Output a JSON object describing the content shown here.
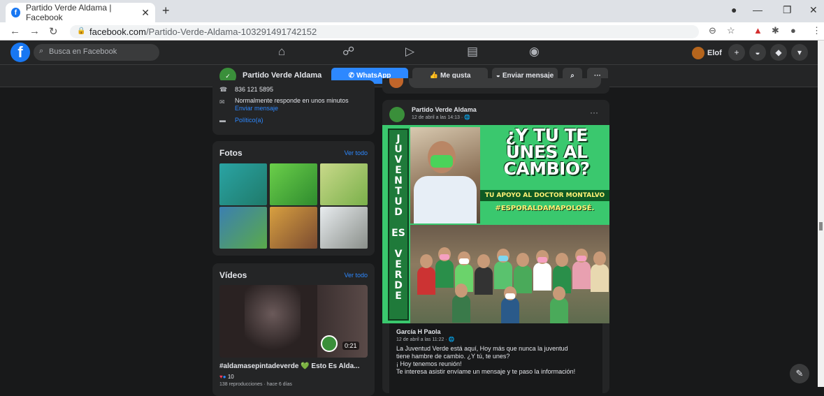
{
  "browser": {
    "tab_title": "Partido Verde Aldama | Facebook",
    "tab_close": "✕",
    "new_tab": "+",
    "url_domain": "facebook.com",
    "url_path": "/Partido-Verde-Aldama-103291491742152",
    "minimize": "—",
    "restore": "❐",
    "close": "✕"
  },
  "fb_header": {
    "logo": "f",
    "search_placeholder": "Busca en Facebook",
    "profile_name": "Elof"
  },
  "page_bar": {
    "page_name": "Partido Verde Aldama",
    "whatsapp_label": "WhatsApp",
    "like_label": "Me gusta",
    "message_label": "Enviar mensaje",
    "more_label": "···"
  },
  "info": {
    "phone": "836 121 5895",
    "response": "Normalmente responde en unos minutos",
    "send_message": "Enviar mensaje",
    "category": "Político(a)"
  },
  "photos": {
    "title": "Fotos",
    "see_all": "Ver todo"
  },
  "videos": {
    "title": "Vídeos",
    "see_all": "Ver todo",
    "video_title": "#aldamasepintadeverde 💚 Esto Es Alda...",
    "reactions": "10",
    "views": "138 reproducciones · hace 6 días",
    "duration": "0:21"
  },
  "post": {
    "author": "Partido Verde Aldama",
    "date": "12 de abril a las 14:13 · 🌐",
    "more": "···",
    "strip_text": [
      "J",
      "U",
      "V",
      "E",
      "N",
      "T",
      "U",
      "D",
      "",
      "ES",
      "",
      "V",
      "E",
      "R",
      "D",
      "E"
    ],
    "headline_line1": "¿Y TU TE",
    "headline_line2": "ÚNES AL",
    "headline_line3": "CAMBIO?",
    "tagline1": "TU APOYO AL DOCTOR MONTALVO",
    "tagline2": "#ESPORALDAMAPOLOSÉ.",
    "comment_author": "García H Paola",
    "comment_date": "12 de abril a las 11:22 · 🌐",
    "comment_text_1": "La Juventud Verde está aquí,  Hoy más que nunca la juventud",
    "comment_text_2": "tiene hambre de cambio. ¿Y tú, te unes?",
    "comment_text_3": "¡ Hoy tenemos reunión!",
    "comment_text_4": "Te interesa asistir envíame un mensaje y te paso la información!"
  },
  "colors": {
    "fb_blue": "#1877f2",
    "whatsapp_btn": "#2d88ff",
    "poster_green": "#3ac86e",
    "dark_bg": "#18191a",
    "card_bg": "#242526"
  }
}
